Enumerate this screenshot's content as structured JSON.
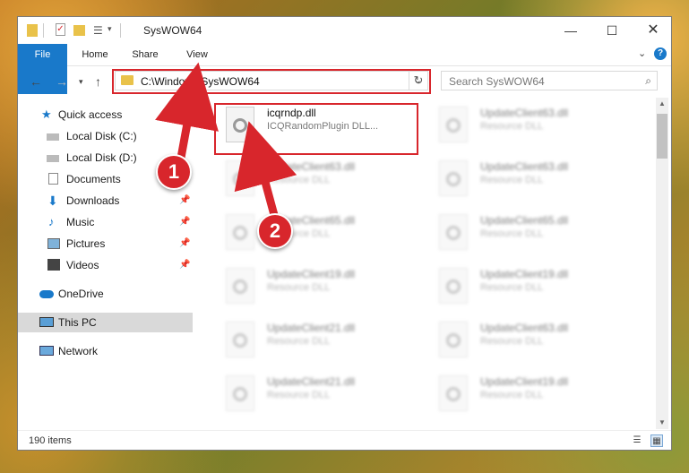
{
  "window": {
    "title": "SysWOW64"
  },
  "ribbon": {
    "tabs": [
      "File",
      "Home",
      "Share",
      "View"
    ]
  },
  "address": {
    "path": "C:\\Windows\\SysWOW64"
  },
  "search": {
    "placeholder": "Search SysWOW64"
  },
  "nav": {
    "items": [
      {
        "label": "Quick access"
      },
      {
        "label": "Local Disk (C:)"
      },
      {
        "label": "Local Disk (D:)"
      },
      {
        "label": "Documents"
      },
      {
        "label": "Downloads"
      },
      {
        "label": "Music"
      },
      {
        "label": "Pictures"
      },
      {
        "label": "Videos"
      },
      {
        "label": "OneDrive"
      },
      {
        "label": "This PC"
      },
      {
        "label": "Network"
      }
    ]
  },
  "files": [
    {
      "name": "icqrndp.dll",
      "desc": "ICQRandomPlugin DLL..."
    },
    {
      "name": "UpdateClient63.dll",
      "desc": "Resource DLL"
    },
    {
      "name": "UpdateClient63.dll",
      "desc": "Resource DLL"
    },
    {
      "name": "UpdateClient63.dll",
      "desc": "Resource DLL"
    },
    {
      "name": "UpdateClient65.dll",
      "desc": "Resource DLL"
    },
    {
      "name": "UpdateClient65.dll",
      "desc": "Resource DLL"
    },
    {
      "name": "UpdateClient19.dll",
      "desc": "Resource DLL"
    },
    {
      "name": "UpdateClient19.dll",
      "desc": "Resource DLL"
    },
    {
      "name": "UpdateClient21.dll",
      "desc": "Resource DLL"
    },
    {
      "name": "UpdateClient63.dll",
      "desc": "Resource DLL"
    },
    {
      "name": "UpdateClient21.dll",
      "desc": "Resource DLL"
    },
    {
      "name": "UpdateClient19.dll",
      "desc": "Resource DLL"
    }
  ],
  "status": {
    "count": "190 items"
  },
  "callouts": [
    "1",
    "2"
  ],
  "colors": {
    "accent": "#1979ca",
    "highlight": "#d8262c"
  }
}
